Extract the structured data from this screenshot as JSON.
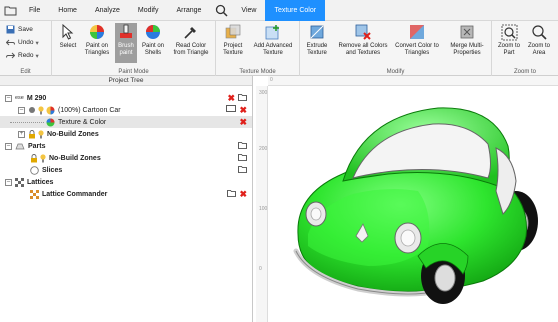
{
  "menubar": {
    "items": [
      {
        "label": "File"
      },
      {
        "label": "Home"
      },
      {
        "label": "Analyze"
      },
      {
        "label": "Modify"
      },
      {
        "label": "Arrange"
      },
      {
        "label": "View"
      },
      {
        "label": "Texture Color"
      }
    ]
  },
  "ribbon": {
    "edit": {
      "save": "Save",
      "undo": "Undo",
      "redo": "Redo",
      "group": "Edit"
    },
    "paint_mode": {
      "select": "Select",
      "paint_triangles": "Paint on Triangles",
      "brush": "Brush paint",
      "paint_shells": "Paint on Shells",
      "read_color": "Read Color from Triangle",
      "group": "Paint Mode"
    },
    "texture_mode": {
      "project": "Project Texture",
      "add_advanced": "Add Advanced Texture",
      "group": "Texture Mode"
    },
    "modify": {
      "extrude": "Extrude Texture",
      "remove_all": "Remove all Colors and Textures",
      "convert": "Convert Color to Triangles",
      "merge": "Merge Multi-Properties",
      "group": "Modify"
    },
    "zoom": {
      "zoom_part": "Zoom to Part",
      "zoom_area": "Zoom to Area",
      "group": "Zoom to"
    }
  },
  "tree": {
    "header": "Project Tree",
    "root": "M 290",
    "root_prefix": "ese",
    "part": "(100%) Cartoon Car",
    "texture": "Texture & Color",
    "nobuild1": "No-Build Zones",
    "parts": "Parts",
    "nobuild2": "No-Build Zones",
    "slices": "Slices",
    "lattices": "Lattices",
    "lattice_cmd": "Lattice Commander"
  },
  "rulers": {
    "h_tick": "0",
    "v_ticks": [
      "300",
      "200",
      "100",
      "0"
    ]
  },
  "colors": {
    "accent": "#1e90ff",
    "car_green": "#2ee52e",
    "delete_red": "#e0201b"
  }
}
